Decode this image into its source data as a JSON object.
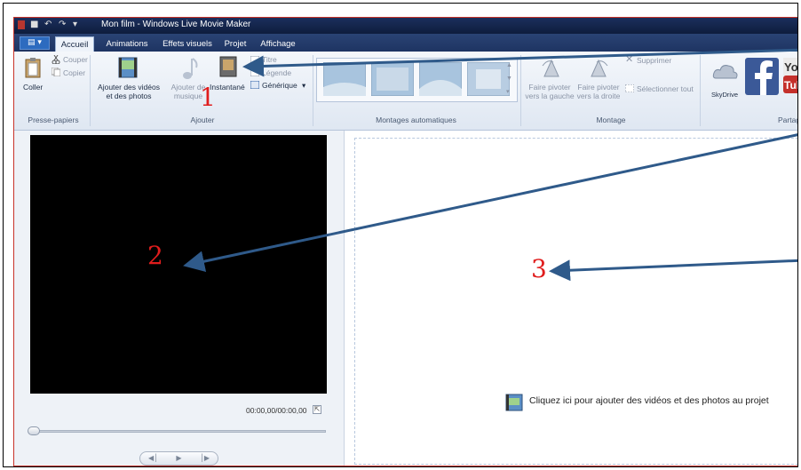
{
  "window": {
    "title": "Mon film - Windows Live Movie Maker"
  },
  "tabs": [
    {
      "label": "Accueil",
      "active": true
    },
    {
      "label": "Animations"
    },
    {
      "label": "Effets visuels"
    },
    {
      "label": "Projet"
    },
    {
      "label": "Affichage"
    }
  ],
  "ribbon": {
    "clipboard": {
      "paste": "Coller",
      "cut": "Couper",
      "copy": "Copier",
      "group": "Presse-papiers"
    },
    "add": {
      "add_videos_line1": "Ajouter des vidéos",
      "add_videos_line2": "et des photos",
      "add_music_line1": "Ajouter de",
      "add_music_line2": "musique",
      "snapshot": "Instantané",
      "title": "Titre",
      "caption": "Légende",
      "credits": "Générique",
      "group": "Ajouter"
    },
    "automovie": {
      "group": "Montages automatiques"
    },
    "editing": {
      "rotate_left_line1": "Faire pivoter",
      "rotate_left_line2": "vers la gauche",
      "rotate_right_line1": "Faire pivoter",
      "rotate_right_line2": "vers la droite",
      "delete": "Supprimer",
      "select_all": "Sélectionner tout",
      "group": "Montage"
    },
    "share": {
      "skydrive": "SkyDrive",
      "group": "Partager"
    }
  },
  "preview": {
    "time": "00:00,00/00:00,00"
  },
  "storyboard": {
    "hint": "Cliquez ici pour ajouter des vidéos et des photos au projet"
  },
  "annotations": {
    "one": "1",
    "two": "2",
    "three": "3"
  },
  "colors": {
    "annotation": "#e01d1d",
    "arrow": "#2f5a8a"
  }
}
